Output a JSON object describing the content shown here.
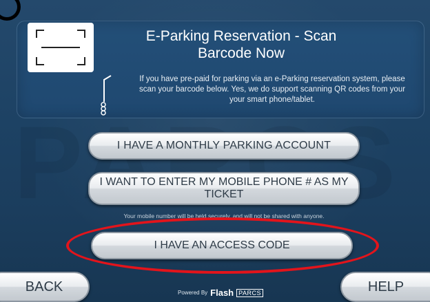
{
  "panel": {
    "title": "E-Parking Reservation - Scan Barcode Now",
    "description": "If you have pre-paid for parking via an e-Parking reservation system, please scan your barcode below. Yes, we do support scanning QR codes from your your smart phone/tablet."
  },
  "buttons": {
    "monthly": "I HAVE A MONTHLY PARKING ACCOUNT",
    "phone": "I WANT TO ENTER MY MOBILE PHONE # AS MY TICKET",
    "access": "I HAVE AN ACCESS CODE",
    "back": "BACK",
    "help": "HELP"
  },
  "note": "Your mobile number will be held securely, and will not be shared with anyone.",
  "footer": {
    "powered_by": "Powered By",
    "brand_a": "Flash",
    "brand_b": "PARCS"
  },
  "colors": {
    "background": "#1f4567",
    "highlight_ring": "#e3141b"
  }
}
